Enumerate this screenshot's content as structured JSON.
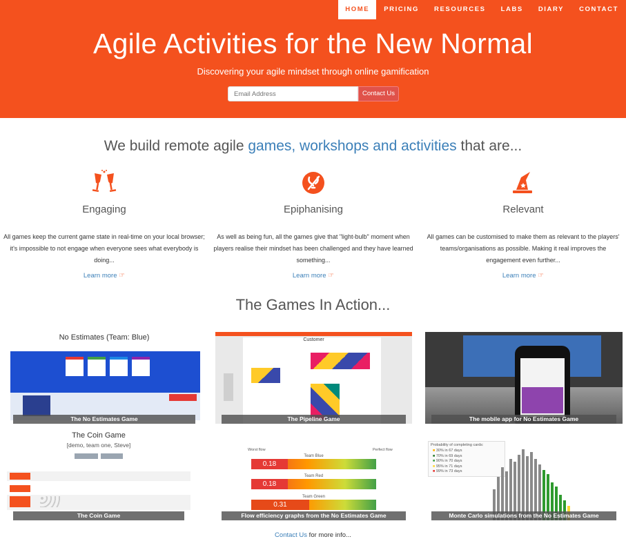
{
  "nav": {
    "items": [
      {
        "label": "HOME"
      },
      {
        "label": "PRICING"
      },
      {
        "label": "RESOURCES"
      },
      {
        "label": "LABS"
      },
      {
        "label": "DIARY"
      },
      {
        "label": "CONTACT"
      }
    ]
  },
  "hero": {
    "title": "Agile Activities for the New Normal",
    "subtitle": "Discovering your agile mindset through online gamification",
    "email_placeholder": "Email Address",
    "contact_label": "Contact Us"
  },
  "intro": {
    "prefix": "We build remote agile ",
    "highlight": "games, workshops and activities",
    "suffix": " that are..."
  },
  "features": [
    {
      "icon": "champagne-glasses-icon",
      "title": "Engaging",
      "text": "All games keep the current game state in real-time on your local browser; it's impossible to not engage when everyone sees what everybody is doing...",
      "more": "Learn more"
    },
    {
      "icon": "lightbulb-slash-icon",
      "title": "Epiphanising",
      "text": "As well as being fun, all the games give that \"light-bulb\" moment when players realise their mindset has been challenged and they have learned something...",
      "more": "Learn more"
    },
    {
      "icon": "wizard-hat-icon",
      "title": "Relevant",
      "text": "All games can be customised to make them as relevant to the players' teams/organisations as possible. Making it real improves the engagement even further...",
      "more": "Learn more"
    }
  ],
  "games": {
    "title": "The Games In Action...",
    "tiles": [
      {
        "caption": "The No Estimates Game",
        "screen_title": "No Estimates (Team: Blue)"
      },
      {
        "caption": "The Pipeline Game",
        "screen_title": "Customer"
      },
      {
        "caption": "The mobile app for No Estimates Game"
      },
      {
        "caption": "The Coin Game",
        "screen_title": "The Coin Game",
        "screen_sub": "[demo, team one, Steve]"
      },
      {
        "caption": "Flow efficiency graphs from the No Estimates Game",
        "bars": [
          {
            "team": "Team Blue",
            "value": "0.18"
          },
          {
            "team": "Team Red",
            "value": "0.18"
          },
          {
            "team": "Team Green",
            "value": "0.31"
          }
        ],
        "worst": "Worst flow",
        "perfect": "Perfect flow"
      },
      {
        "caption": "Monte Carlo simulations from the No Estimates Game",
        "legend_title": "Probability of completing cards:",
        "legend": [
          "30% in 67 days",
          "70% in 69 days",
          "90% in 70 days",
          "95% in 71 days",
          "99% in 73 days"
        ]
      }
    ]
  },
  "footer": {
    "link": "Contact Us",
    "text": " for more info..."
  },
  "colors": {
    "accent": "#f4511e",
    "link": "#3b7fb8"
  }
}
